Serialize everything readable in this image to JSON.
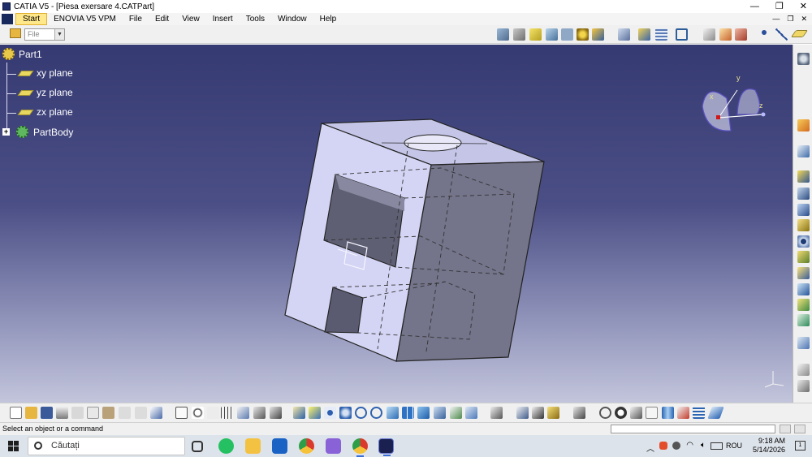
{
  "window": {
    "title": "CATIA V5 - [Piesa exersare 4.CATPart]",
    "controls": [
      "—",
      "❐",
      "✕"
    ],
    "mdi_controls": [
      "—",
      "❐",
      "✕"
    ]
  },
  "menu": {
    "items": [
      "Start",
      "ENOVIA V5 VPM",
      "File",
      "Edit",
      "View",
      "Insert",
      "Tools",
      "Window",
      "Help"
    ]
  },
  "toolbar_top": {
    "file_combo": "File"
  },
  "tree": {
    "root": "Part1",
    "planes": [
      "xy plane",
      "yz plane",
      "zx plane"
    ],
    "body": "PartBody"
  },
  "compass": {
    "x": "x",
    "y": "y",
    "z": "z"
  },
  "status": {
    "message": "Select an object or a command"
  },
  "taskbar": {
    "search_placeholder": "Căutați",
    "language": "ROU",
    "time": "9:18 AM",
    "date": "5/14/2026",
    "notifications": "1"
  },
  "colors": {
    "viewport_top": "#363a72",
    "viewport_bottom": "#c3c5dc",
    "part_light": "#d2d2f2",
    "part_dark": "#737386",
    "menu_start_highlight": "#ffe88a"
  }
}
